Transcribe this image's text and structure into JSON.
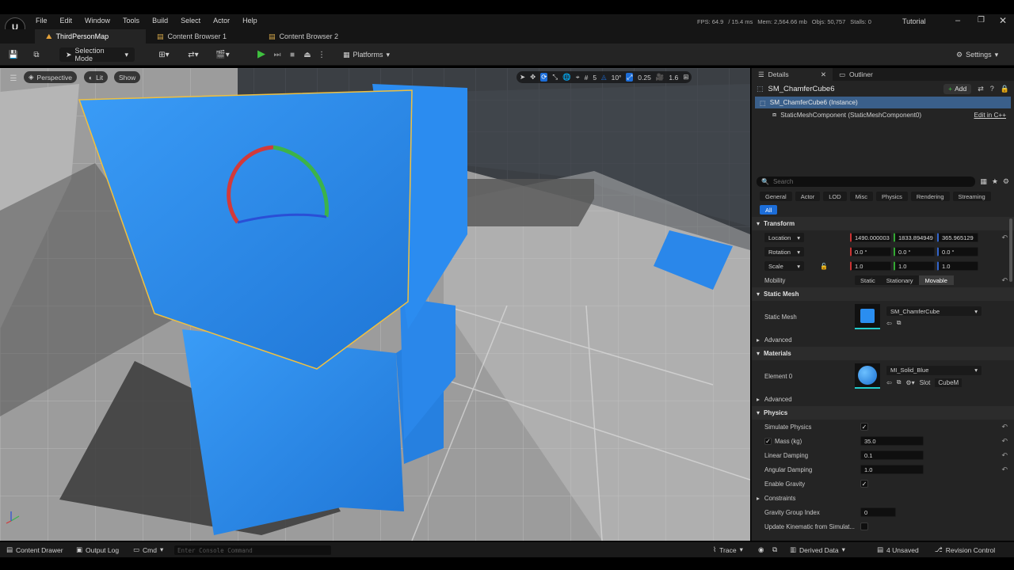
{
  "menu": {
    "items": [
      "File",
      "Edit",
      "Window",
      "Tools",
      "Build",
      "Select",
      "Actor",
      "Help"
    ]
  },
  "stats": {
    "fps": "FPS: 64.9",
    "ms": "/ 15.4 ms",
    "mem": "Mem: 2,564.66 mb",
    "objs": "Objs: 50,757",
    "stalls": "Stalls: 0",
    "project": "Tutorial"
  },
  "tabs": [
    {
      "label": "ThirdPersonMap"
    },
    {
      "label": "Content Browser 1"
    },
    {
      "label": "Content Browser 2"
    }
  ],
  "toolbar": {
    "selection_mode": "Selection Mode",
    "platforms": "Platforms",
    "settings": "Settings"
  },
  "viewport": {
    "perspective": "Perspective",
    "lit": "Lit",
    "show": "Show",
    "grid_snap": "5",
    "rot_snap": "10°",
    "scale_snap": "0.25",
    "cam_speed": "1.6"
  },
  "details": {
    "tab_details": "Details",
    "tab_outliner": "Outliner",
    "actor_name": "SM_ChamferCube6",
    "add_label": "Add",
    "instance": "SM_ChamferCube6 (Instance)",
    "component": "StaticMeshComponent (StaticMeshComponent0)",
    "edit_cpp": "Edit in C++",
    "search_placeholder": "Search",
    "categories": [
      "General",
      "Actor",
      "LOD",
      "Misc",
      "Physics",
      "Rendering",
      "Streaming",
      "All"
    ],
    "transform": {
      "header": "Transform",
      "location_label": "Location",
      "location": [
        "1490.000003",
        "1833.894949",
        "365.965129"
      ],
      "rotation_label": "Rotation",
      "rotation": [
        "0.0 °",
        "0.0 °",
        "0.0 °"
      ],
      "scale_label": "Scale",
      "scale": [
        "1.0",
        "1.0",
        "1.0"
      ],
      "mobility_label": "Mobility",
      "mobility": [
        "Static",
        "Stationary",
        "Movable"
      ]
    },
    "static_mesh": {
      "header": "Static Mesh",
      "label": "Static Mesh",
      "value": "SM_ChamferCube",
      "advanced": "Advanced"
    },
    "materials": {
      "header": "Materials",
      "element_label": "Element 0",
      "value": "MI_Solid_Blue",
      "slot_label": "Slot",
      "slot_value": "CubeM",
      "advanced": "Advanced"
    },
    "physics": {
      "header": "Physics",
      "simulate": "Simulate Physics",
      "mass_label": "Mass (kg)",
      "mass": "35.0",
      "linear_label": "Linear Damping",
      "linear": "0.1",
      "angular_label": "Angular Damping",
      "angular": "1.0",
      "gravity_label": "Enable Gravity",
      "constraints": "Constraints",
      "gravity_group_label": "Gravity Group Index",
      "gravity_group": "0",
      "kinematic_label": "Update Kinematic from Simulat..."
    }
  },
  "status": {
    "content_drawer": "Content Drawer",
    "output_log": "Output Log",
    "cmd": "Cmd",
    "console_placeholder": "Enter Console Command",
    "trace": "Trace",
    "derived": "Derived Data",
    "unsaved": "4 Unsaved",
    "revision": "Revision Control"
  },
  "colors": {
    "accent": "#1c6dd8",
    "cube_blue": "#2a8ef0",
    "panel": "#242424",
    "selection_outline": "#f0c040"
  }
}
